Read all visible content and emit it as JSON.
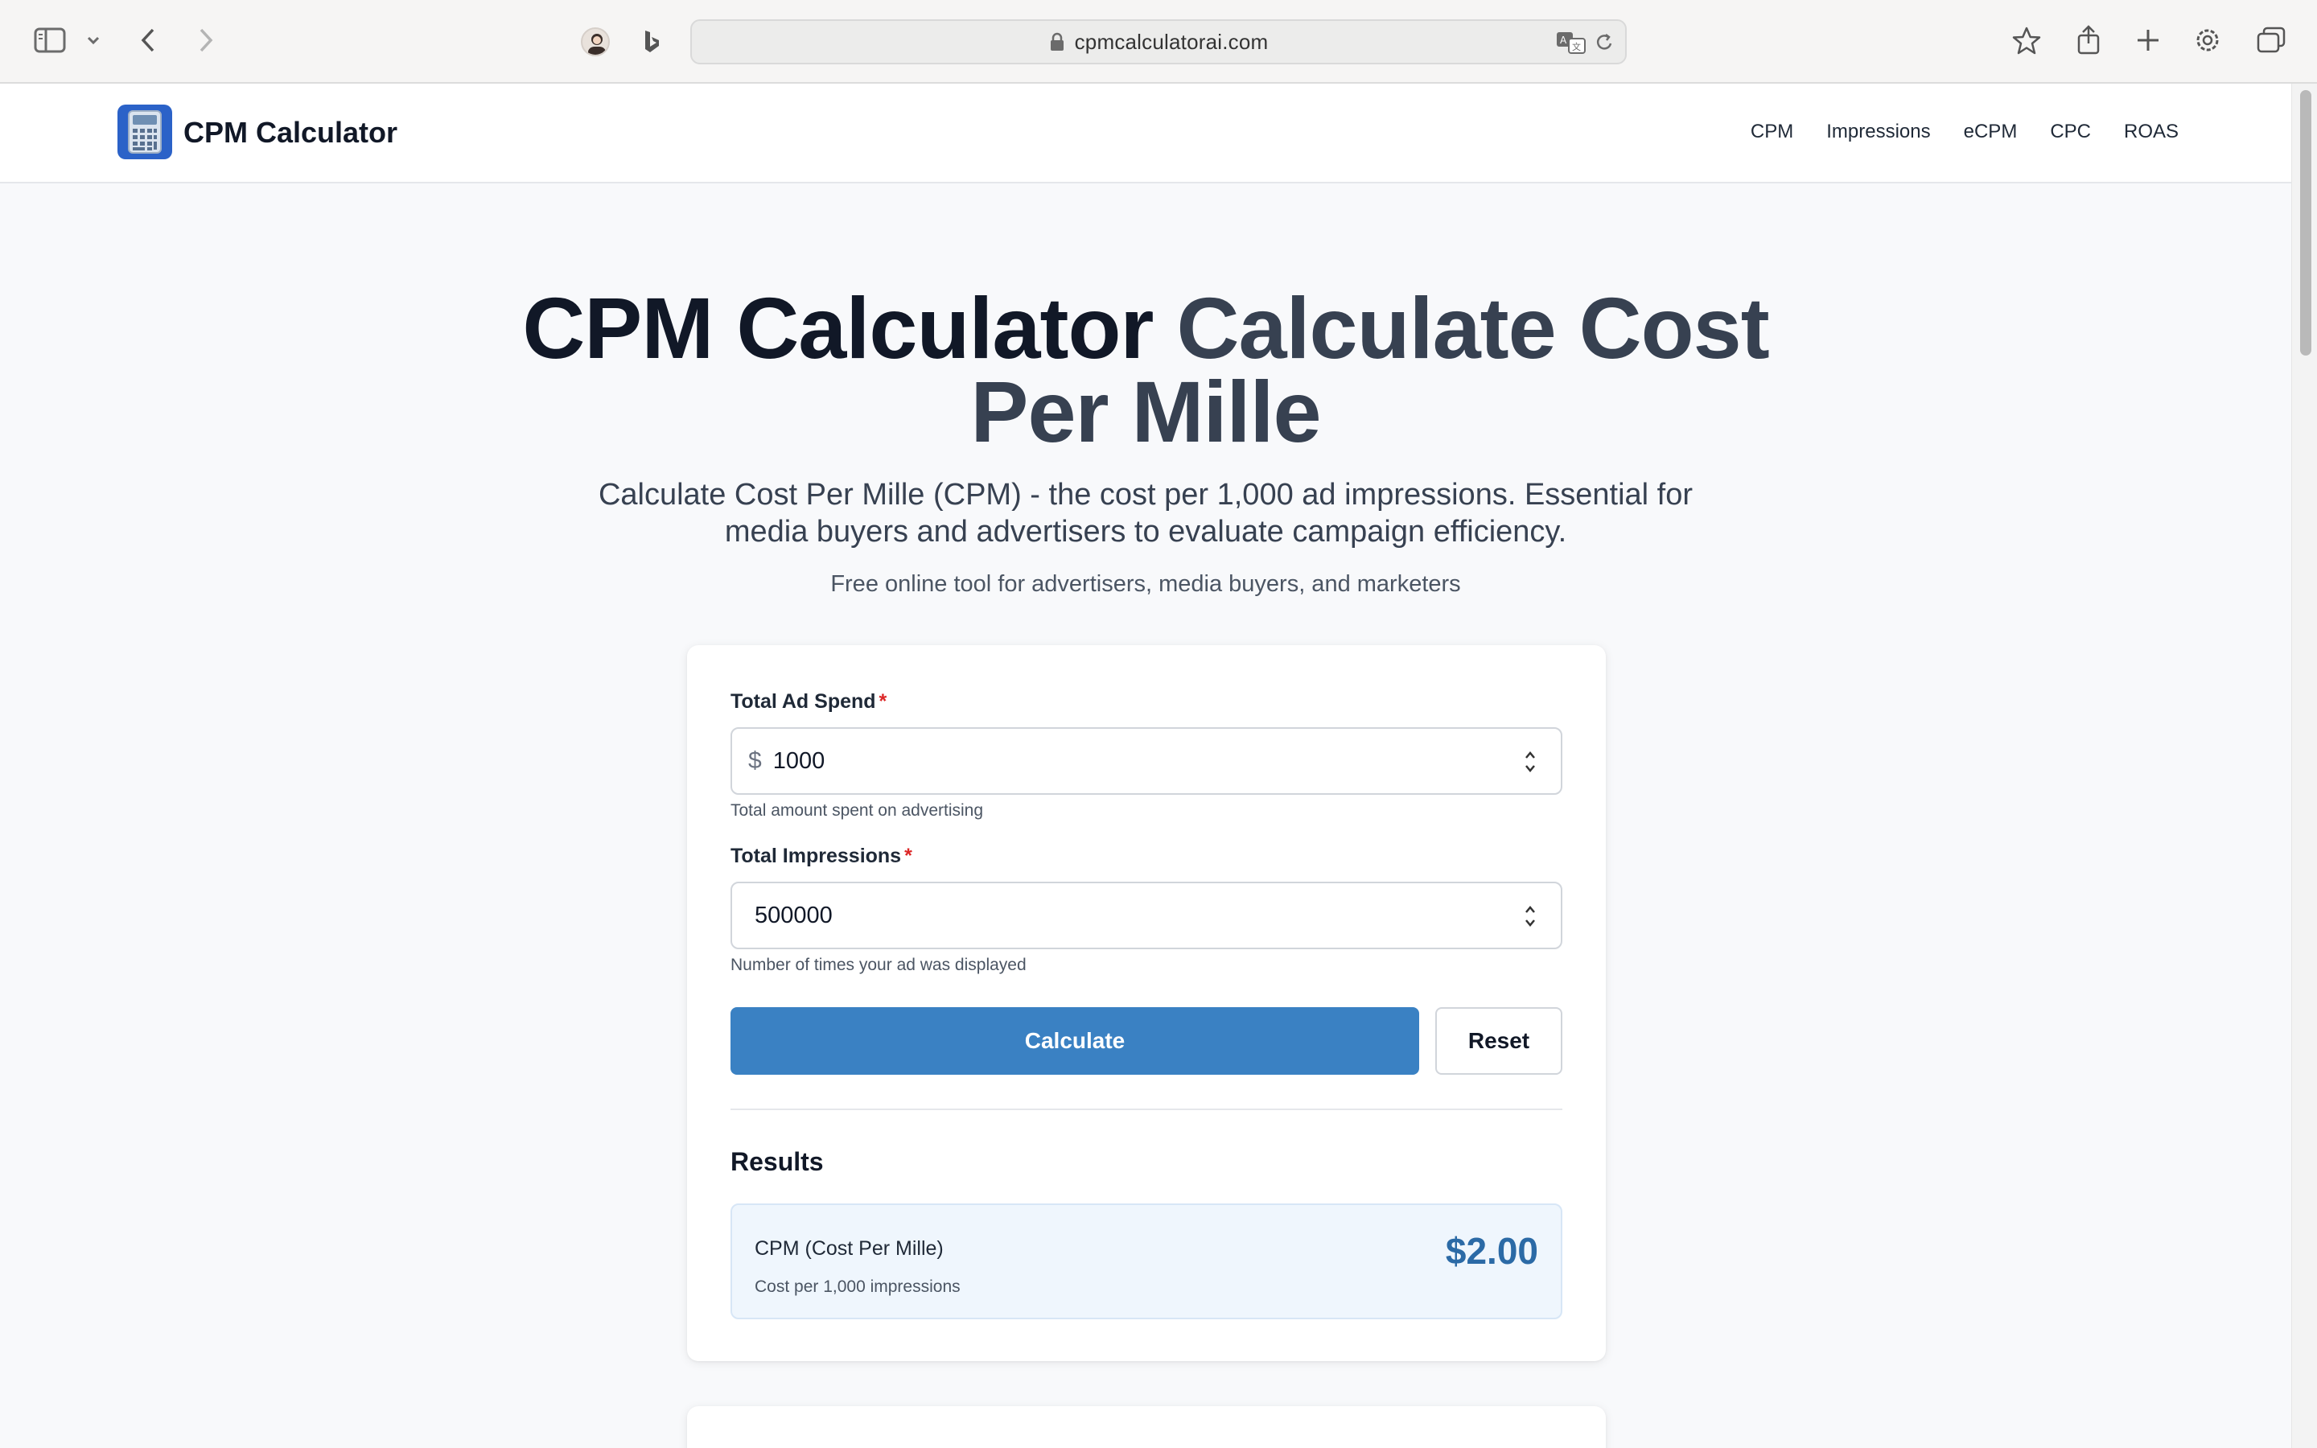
{
  "browser": {
    "url": "cpmcalculatorai.com"
  },
  "site": {
    "brand": "CPM Calculator",
    "nav": [
      "CPM",
      "Impressions",
      "eCPM",
      "CPC",
      "ROAS"
    ]
  },
  "hero": {
    "title_main": "CPM Calculator",
    "title_accent": "Calculate Cost Per Mille",
    "description": "Calculate Cost Per Mille (CPM) - the cost per 1,000 ad impressions. Essential for media buyers and advertisers to evaluate campaign efficiency.",
    "subtitle": "Free online tool for advertisers, media buyers, and marketers"
  },
  "form": {
    "spend": {
      "label": "Total Ad Spend",
      "required_mark": "*",
      "prefix": "$",
      "value": "1000",
      "help": "Total amount spent on advertising"
    },
    "impressions": {
      "label": "Total Impressions",
      "required_mark": "*",
      "value": "500000",
      "help": "Number of times your ad was displayed"
    },
    "calculate_label": "Calculate",
    "reset_label": "Reset"
  },
  "results": {
    "title": "Results",
    "cpm_label": "CPM (Cost Per Mille)",
    "cpm_sub": "Cost per 1,000 impressions",
    "cpm_value": "$2.00"
  },
  "colors": {
    "primary": "#3a81c3",
    "result_value": "#2b6aa6",
    "required": "#dc2626",
    "logo_bg": "#2b62c8"
  }
}
